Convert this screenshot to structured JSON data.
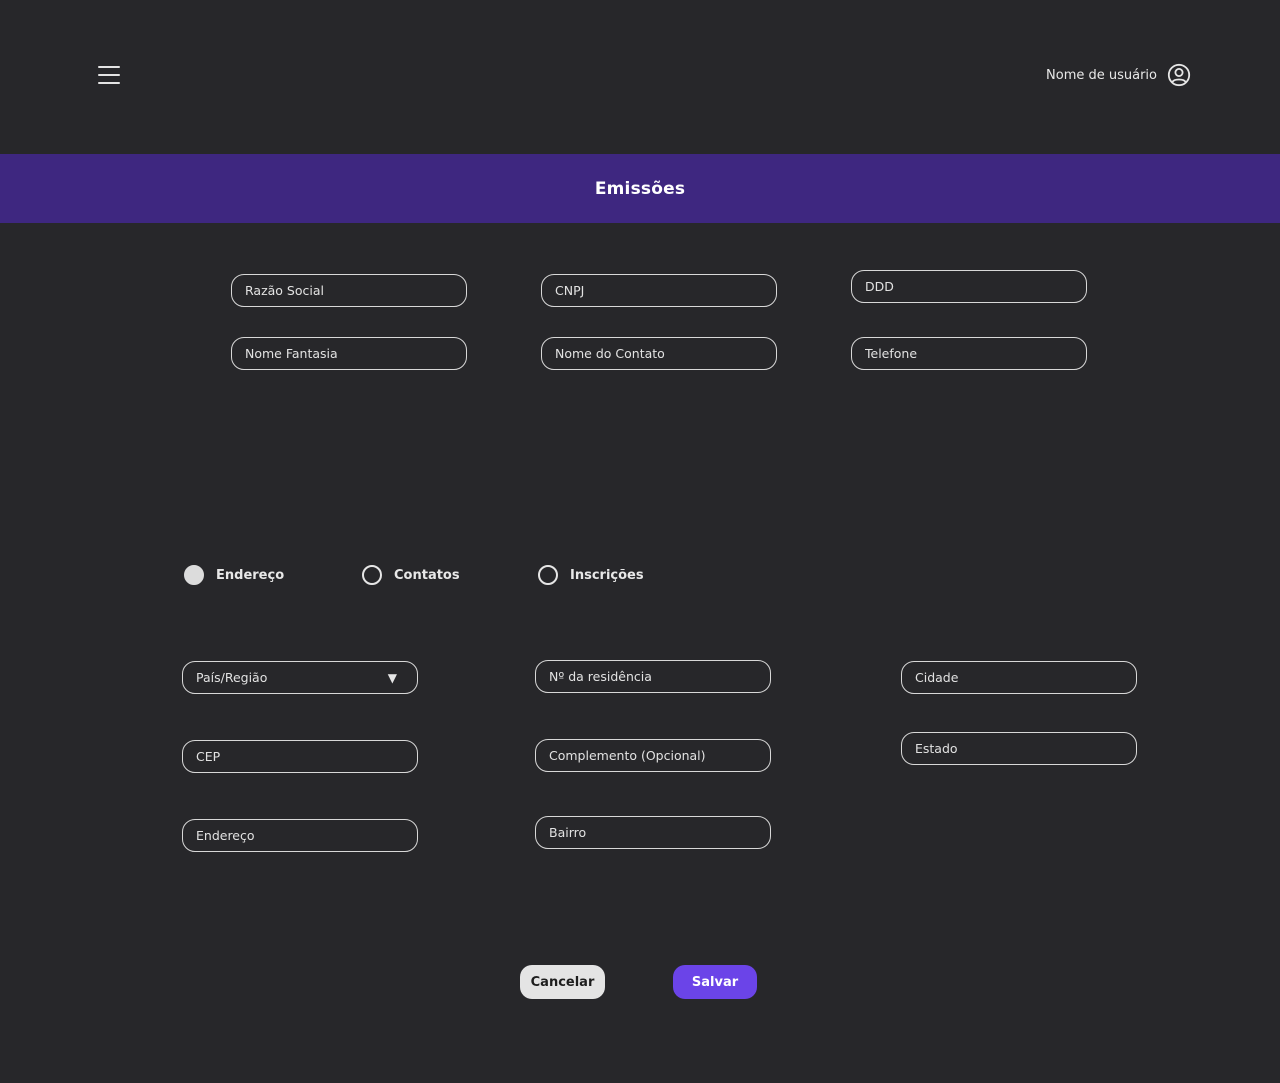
{
  "header": {
    "menu_icon": "hamburger-menu-icon",
    "username": "Nome de usuário",
    "user_icon": "user-circle-icon"
  },
  "banner": {
    "title": "Emissões",
    "color": "#3e2780"
  },
  "company_form": {
    "razao_social": "Razão Social",
    "cnpj": "CNPJ",
    "ddd": "DDD",
    "nome_fantasia": "Nome Fantasia",
    "nome_contato": "Nome do Contato",
    "telefone": "Telefone"
  },
  "tabs": [
    {
      "label": "Endereço",
      "selected": true
    },
    {
      "label": "Contatos",
      "selected": false
    },
    {
      "label": "Inscrições",
      "selected": false
    }
  ],
  "address_form": {
    "pais_regiao": "País/Região",
    "numero_residencia": "Nº da residência",
    "cidade": "Cidade",
    "cep": "CEP",
    "complemento": "Complemento (Opcional)",
    "estado": "Estado",
    "endereco": "Endereço",
    "bairro": "Bairro"
  },
  "actions": {
    "cancel_label": "Cancelar",
    "save_label": "Salvar",
    "save_color": "#6b44e8"
  }
}
